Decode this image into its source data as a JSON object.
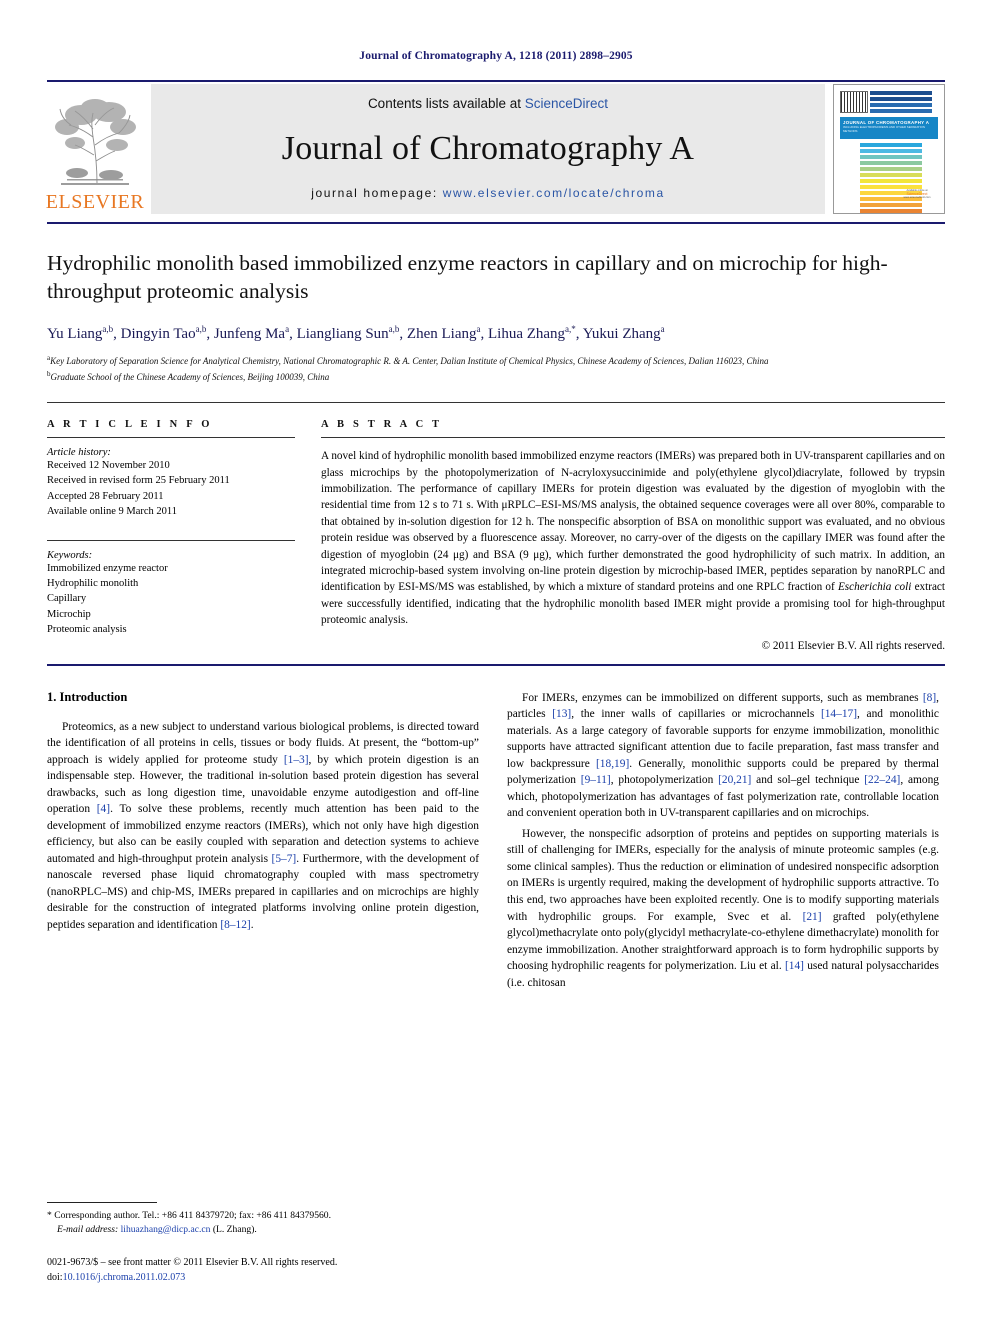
{
  "running_head": "Journal of Chromatography A, 1218 (2011) 2898–2905",
  "masthead": {
    "contents_prefix": "Contents lists available at ",
    "sciencedirect": "ScienceDirect",
    "journal_name": "Journal of Chromatography A",
    "homepage_prefix": "journal homepage: ",
    "homepage_url": "www.elsevier.com/locate/chroma",
    "publisher_wordmark": "ELSEVIER",
    "cover": {
      "title": "JOURNAL OF CHROMATOGRAPHY A",
      "subtitle": "INCLUDING ELECTROPHORESIS AND OTHER SEPARATION METHODS",
      "sciencedirect_note": "Available online at",
      "sciencedirect_name": "ScienceDirect",
      "sciencedirect_sub": "www.sciencedirect.com"
    },
    "accent_blue": "#2a55a5",
    "elsevier_orange": "#E87722"
  },
  "article": {
    "title": "Hydrophilic monolith based immobilized enzyme reactors in capillary and on microchip for high-throughput proteomic analysis",
    "authors": [
      {
        "name": "Yu Liang",
        "sup": "a,b"
      },
      {
        "name": "Dingyin Tao",
        "sup": "a,b"
      },
      {
        "name": "Junfeng Ma",
        "sup": "a"
      },
      {
        "name": "Liangliang Sun",
        "sup": "a,b"
      },
      {
        "name": "Zhen Liang",
        "sup": "a"
      },
      {
        "name": "Lihua Zhang",
        "sup": "a,*"
      },
      {
        "name": "Yukui Zhang",
        "sup": "a"
      }
    ],
    "affiliations": [
      {
        "label": "a",
        "text": "Key Laboratory of Separation Science for Analytical Chemistry, National Chromatographic R. & A. Center, Dalian Institute of Chemical Physics, Chinese Academy of Sciences, Dalian 116023, China"
      },
      {
        "label": "b",
        "text": "Graduate School of the Chinese Academy of Sciences, Beijing 100039, China"
      }
    ]
  },
  "article_info": {
    "heading": "A R T I C L E   I N F O",
    "history_label": "Article history:",
    "history": [
      "Received 12 November 2010",
      "Received in revised form 25 February 2011",
      "Accepted 28 February 2011",
      "Available online 9 March 2011"
    ],
    "keywords_label": "Keywords:",
    "keywords": [
      "Immobilized enzyme reactor",
      "Hydrophilic monolith",
      "Capillary",
      "Microchip",
      "Proteomic analysis"
    ]
  },
  "abstract": {
    "heading": "A B S T R A C T",
    "part1": "A novel kind of hydrophilic monolith based immobilized enzyme reactors (IMERs) was prepared both in UV-transparent capillaries and on glass microchips by the photopolymerization of N-acryloxysuccinimide and poly(ethylene glycol)diacrylate, followed by trypsin immobilization. The performance of capillary IMERs for protein digestion was evaluated by the digestion of myoglobin with the residential time from 12 s to 71 s. With μRPLC–ESI-MS/MS analysis, the obtained sequence coverages were all over 80%, comparable to that obtained by in-solution digestion for 12 h. The nonspecific absorption of BSA on monolithic support was evaluated, and no obvious protein residue was observed by a fluorescence assay. Moreover, no carry-over of the digests on the capillary IMER was found after the digestion of myoglobin (24 μg) and BSA (9 μg), which further demonstrated the good hydrophilicity of such matrix. In addition, an integrated microchip-based system involving on-line protein digestion by microchip-based IMER, peptides separation by nanoRPLC and identification by ESI-MS/MS was established, by which a mixture of standard proteins and one RPLC fraction of ",
    "italic_species": "Escherichia coli",
    "part2": " extract were successfully identified, indicating that the hydrophilic monolith based IMER might provide a promising tool for high-throughput proteomic analysis.",
    "copyright": "© 2011 Elsevier B.V. All rights reserved."
  },
  "sections": {
    "intro_heading": "1.  Introduction",
    "left_paragraphs": [
      {
        "segments": [
          {
            "t": "Proteomics, as a new subject to understand various biological problems, is directed toward the identification of all proteins in cells, tissues or body fluids. At present, the “bottom-up” approach is widely applied for proteome study "
          },
          {
            "t": "[1–3]",
            "k": "ref"
          },
          {
            "t": ", by which protein digestion is an indispensable step. However, the traditional in-solution based protein digestion has several drawbacks, such as long digestion time, unavoidable enzyme autodigestion and off-line operation "
          },
          {
            "t": "[4]",
            "k": "ref"
          },
          {
            "t": ". To solve these problems, recently much attention has been paid to the development of immobilized enzyme reactors (IMERs), which not only have high digestion efficiency, but also can be easily coupled with separation and detection systems to achieve automated and high-throughput protein analysis "
          },
          {
            "t": "[5–7]",
            "k": "ref"
          },
          {
            "t": ". Furthermore, with the development of nanoscale reversed phase liquid chromatography coupled with mass spectrometry (nanoRPLC–MS) and chip-MS, IMERs prepared in capillaries and on microchips are highly desirable for the construction of integrated platforms involving online protein digestion, peptides separation and identification "
          },
          {
            "t": "[8–12]",
            "k": "ref"
          },
          {
            "t": "."
          }
        ]
      }
    ],
    "right_paragraphs": [
      {
        "indent": true,
        "segments": [
          {
            "t": "For IMERs, enzymes can be immobilized on different supports, such as membranes "
          },
          {
            "t": "[8]",
            "k": "ref"
          },
          {
            "t": ", particles "
          },
          {
            "t": "[13]",
            "k": "ref"
          },
          {
            "t": ", the inner walls of capillaries or microchannels "
          },
          {
            "t": "[14–17]",
            "k": "ref"
          },
          {
            "t": ", and monolithic materials. As a large category of favorable supports for enzyme immobilization, monolithic supports have attracted significant attention due to facile preparation, fast mass transfer and low backpressure "
          },
          {
            "t": "[18,19]",
            "k": "ref"
          },
          {
            "t": ". Generally, monolithic supports could be prepared by thermal polymerization "
          },
          {
            "t": "[9–11]",
            "k": "ref"
          },
          {
            "t": ", photopolymerization "
          },
          {
            "t": "[20,21]",
            "k": "ref"
          },
          {
            "t": " and sol–gel technique "
          },
          {
            "t": "[22–24]",
            "k": "ref"
          },
          {
            "t": ", among which, photopolymerization has advantages of fast polymerization rate, controllable location and convenient operation both in UV-transparent capillaries and on microchips."
          }
        ]
      },
      {
        "indent": true,
        "segments": [
          {
            "t": "However, the nonspecific adsorption of proteins and peptides on supporting materials is still of challenging for IMERs, especially for the analysis of minute proteomic samples (e.g. some clinical samples). Thus the reduction or elimination of undesired nonspecific adsorption on IMERs is urgently required, making the development of hydrophilic supports attractive. To this end, two approaches have been exploited recently. One is to modify supporting materials with hydrophilic groups. For example, Svec et al. "
          },
          {
            "t": "[21]",
            "k": "ref"
          },
          {
            "t": " grafted poly(ethylene glycol)methacrylate onto poly(glycidyl methacrylate-co-ethylene dimethacrylate) monolith for enzyme immobilization. Another straightforward approach is to form hydrophilic supports by choosing hydrophilic reagents for polymerization. Liu et al. "
          },
          {
            "t": "[14]",
            "k": "ref"
          },
          {
            "t": " used natural polysaccharides (i.e. chitosan"
          }
        ]
      }
    ]
  },
  "footnotes": {
    "corresponding": "* Corresponding author. Tel.: +86 411 84379720; fax: +86 411 84379560.",
    "email_label": "E-mail address:",
    "email": "lihuazhang@dicp.ac.cn",
    "email_suffix": "(L. Zhang).",
    "imprint": "0021-9673/$ – see front matter © 2011 Elsevier B.V. All rights reserved.",
    "doi_label": "doi:",
    "doi": "10.1016/j.chroma.2011.02.073"
  }
}
